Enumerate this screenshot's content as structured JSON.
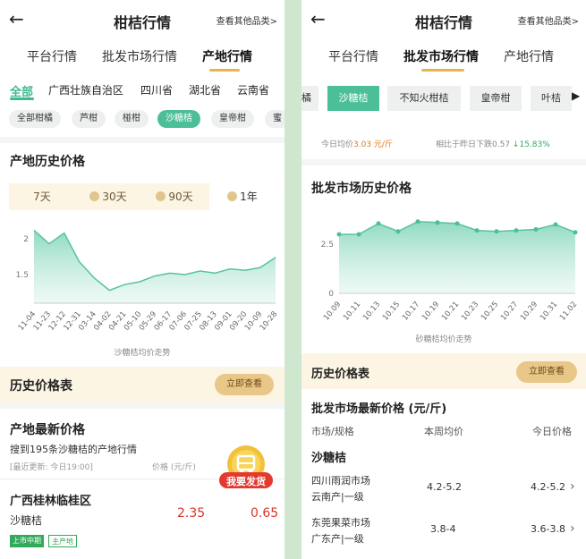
{
  "left": {
    "header": {
      "back": "←",
      "title": "柑桔行情",
      "more": "查看其他品类>"
    },
    "tabs": [
      "平台行情",
      "批发市场行情",
      "产地行情"
    ],
    "provinces": [
      "全部",
      "广西壮族自治区",
      "四川省",
      "湖北省",
      "云南省"
    ],
    "varieties": [
      "全部柑橘",
      "芦柑",
      "椪柑",
      "沙糖桔",
      "皇帝柑",
      "蜜"
    ],
    "history": {
      "title": "产地历史价格",
      "ranges": [
        "7天",
        "30天",
        "90天",
        "1年"
      ],
      "chart_caption": "沙糖桔均价走势"
    },
    "history_table": {
      "title": "历史价格表",
      "button": "立即查看"
    },
    "latest": {
      "title": "产地最新价格",
      "subtitle": "搜到195条沙糖桔的产地行情",
      "updated": "[最近更新: 今日19:00]",
      "price_unit_label": "价格 (元/斤)",
      "item": {
        "region": "广西桂林临桂区",
        "variety": "沙糖桔",
        "price_low": "2.35",
        "price_high": "0.65",
        "tags": [
          "上市中期",
          "主产地"
        ]
      }
    },
    "fab": {
      "label": "我要发货"
    }
  },
  "right": {
    "header": {
      "back": "←",
      "title": "柑桔行情",
      "more": "查看其他品类>"
    },
    "tabs": [
      "平台行情",
      "批发市场行情",
      "产地行情"
    ],
    "varieties": [
      "橘",
      "沙糖桔",
      "不知火柑桔",
      "皇帝柑",
      "叶桔"
    ],
    "today": {
      "label": "今日均价",
      "value": "3.03 元/斤",
      "compare": "相比于昨日下跌0.57",
      "change": "↓15.83%"
    },
    "history": {
      "title": "批发市场历史价格",
      "chart_caption": "砂糖桔均价走势"
    },
    "history_table": {
      "title": "历史价格表",
      "button": "立即查看"
    },
    "latest": {
      "title": "批发市场最新价格 (元/斤)",
      "columns": [
        "市场/规格",
        "本周均价",
        "今日价格"
      ],
      "group": "沙糖桔",
      "rows": [
        {
          "market": "四川雨润市场",
          "spec": "云南产|一级",
          "week": "4.2-5.2",
          "today": "4.2-5.2"
        },
        {
          "market": "东莞果菜市场",
          "spec": "广东产|一级",
          "week": "3.8-4",
          "today": "3.6-3.8"
        }
      ]
    }
  },
  "chart_data": [
    {
      "type": "area",
      "title": "",
      "xlabel": "沙糖桔均价走势",
      "ylabel": "",
      "ylim": [
        1.1,
        2.3
      ],
      "yticks": [
        2,
        1.5
      ],
      "categories": [
        "11-04",
        "11-23",
        "12-12",
        "12-31",
        "03-14",
        "04-02",
        "04-21",
        "05-10",
        "05-29",
        "06-17",
        "07-06",
        "07-25",
        "08-13",
        "09-01",
        "09-20",
        "10-09",
        "10-28"
      ],
      "series": [
        {
          "values": [
            2.12,
            1.93,
            2.08,
            1.68,
            1.45,
            1.28,
            1.36,
            1.4,
            1.48,
            1.52,
            1.5,
            1.55,
            1.52,
            1.58,
            1.56,
            1.6,
            1.74
          ]
        }
      ]
    },
    {
      "type": "area",
      "title": "",
      "xlabel": "砂糖桔均价走势",
      "ylabel": "",
      "ylim": [
        0,
        4
      ],
      "yticks": [
        2.5,
        0
      ],
      "categories": [
        "10.09",
        "10.11",
        "10.13",
        "10.15",
        "10.17",
        "10.19",
        "10.21",
        "10.23",
        "10.25",
        "10.27",
        "10.29",
        "10.31",
        "11.02"
      ],
      "series": [
        {
          "values": [
            3.0,
            3.0,
            3.55,
            3.15,
            3.65,
            3.6,
            3.55,
            3.2,
            3.15,
            3.2,
            3.25,
            3.5,
            3.1
          ]
        }
      ]
    }
  ]
}
